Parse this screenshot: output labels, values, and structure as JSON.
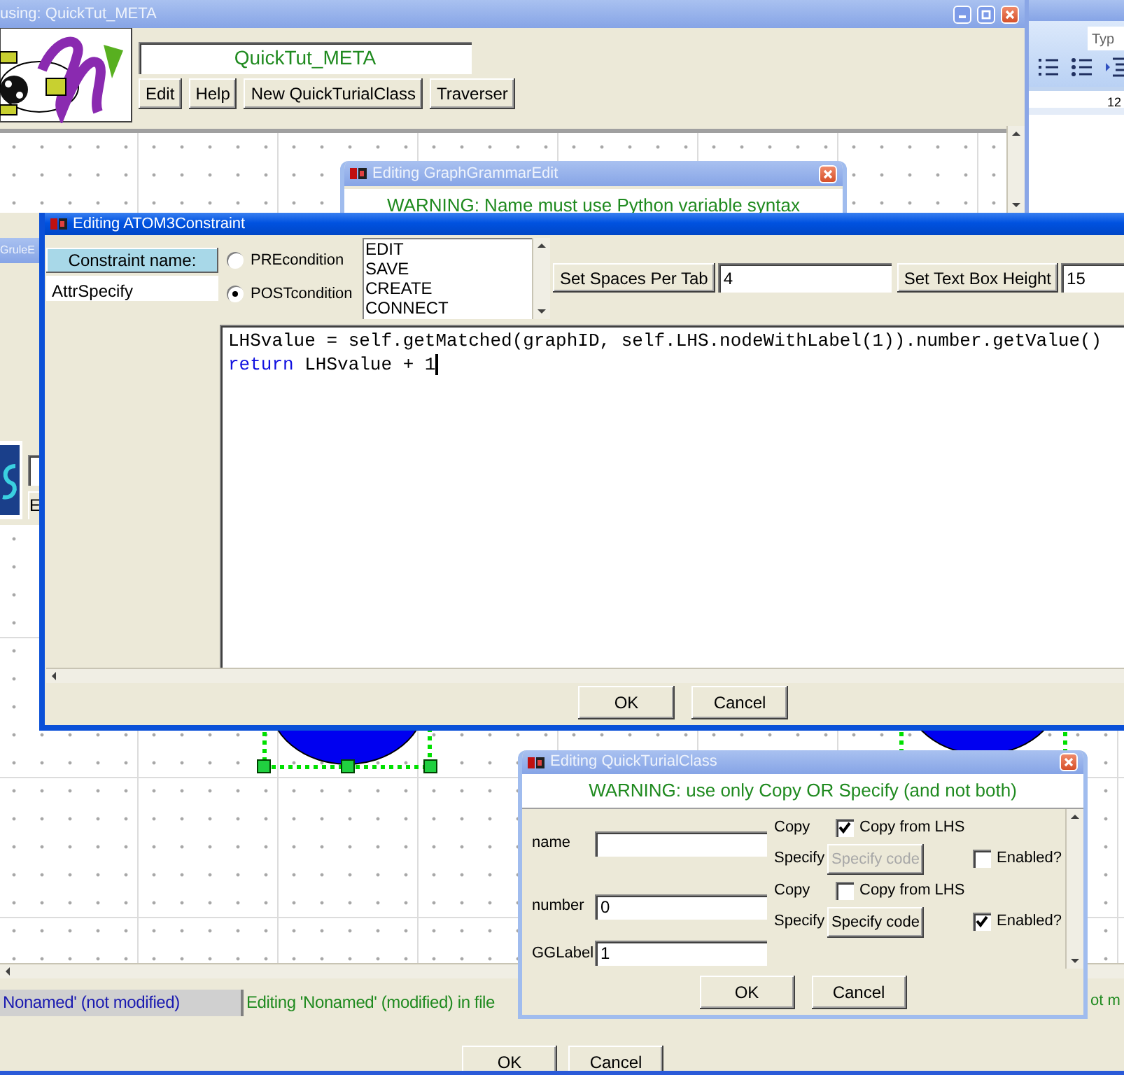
{
  "main_window": {
    "title": "using: QuickTut_META",
    "model_name": "QuickTut_META",
    "toolbar_buttons": [
      "Edit",
      "Help",
      "New QuickTurialClass",
      "Traverser"
    ]
  },
  "word_window": {
    "help_field": "Typ",
    "ruler_label": "12"
  },
  "rule_window": {
    "title": "GruleE",
    "button": "E",
    "status_bar": [
      {
        "text": "Nonamed' (not modified)",
        "kind": "current"
      },
      {
        "text": "Editing 'Nonamed' (modified) in file",
        "kind": "modified"
      },
      {
        "text": "ot m",
        "kind": "modified"
      }
    ],
    "buttons": [
      "OK",
      "Cancel"
    ]
  },
  "grammar_dialog": {
    "title": "Editing GraphGrammarEdit",
    "warning": "WARNING: Name must use Python variable syntax"
  },
  "constraint_dialog": {
    "title": "Editing ATOM3Constraint",
    "name_label": "Constraint name:",
    "name_value": "AttrSpecify",
    "conditions": [
      {
        "label": "PREcondition",
        "selected": false
      },
      {
        "label": "POSTcondition",
        "selected": true
      }
    ],
    "events": [
      "EDIT",
      "SAVE",
      "CREATE",
      "CONNECT"
    ],
    "spaces_button": "Set Spaces Per Tab",
    "spaces_value": "4",
    "height_button": "Set Text Box Height",
    "height_value": "15",
    "code": [
      {
        "text": "LHSvalue = self.getMatched(graphID, self.LHS.nodeWithLabel(1)).number.getValue()"
      },
      {
        "keyword": "return",
        "text": " LHSvalue + 1"
      }
    ],
    "buttons": [
      "OK",
      "Cancel"
    ]
  },
  "class_dialog": {
    "title": "Editing QuickTurialClass",
    "warning": "WARNING: use only Copy OR Specify (and not both)",
    "attributes": [
      {
        "label": "name",
        "copy_label": "Copy",
        "copy_option": "Copy from LHS",
        "copy_checked": true,
        "specify_label": "Specify",
        "specify_button": "Specify code",
        "specify_disabled": true,
        "enabled_label": "Enabled?",
        "enabled_checked": false
      },
      {
        "label": "number",
        "value": "0",
        "copy_label": "Copy",
        "copy_option": "Copy from LHS",
        "copy_checked": false,
        "specify_label": "Specify",
        "specify_button": "Specify code",
        "specify_disabled": false,
        "enabled_label": "Enabled?",
        "enabled_checked": true
      }
    ],
    "gglabel": {
      "label": "GGLabel",
      "value": "1"
    },
    "buttons": [
      "OK",
      "Cancel"
    ]
  }
}
